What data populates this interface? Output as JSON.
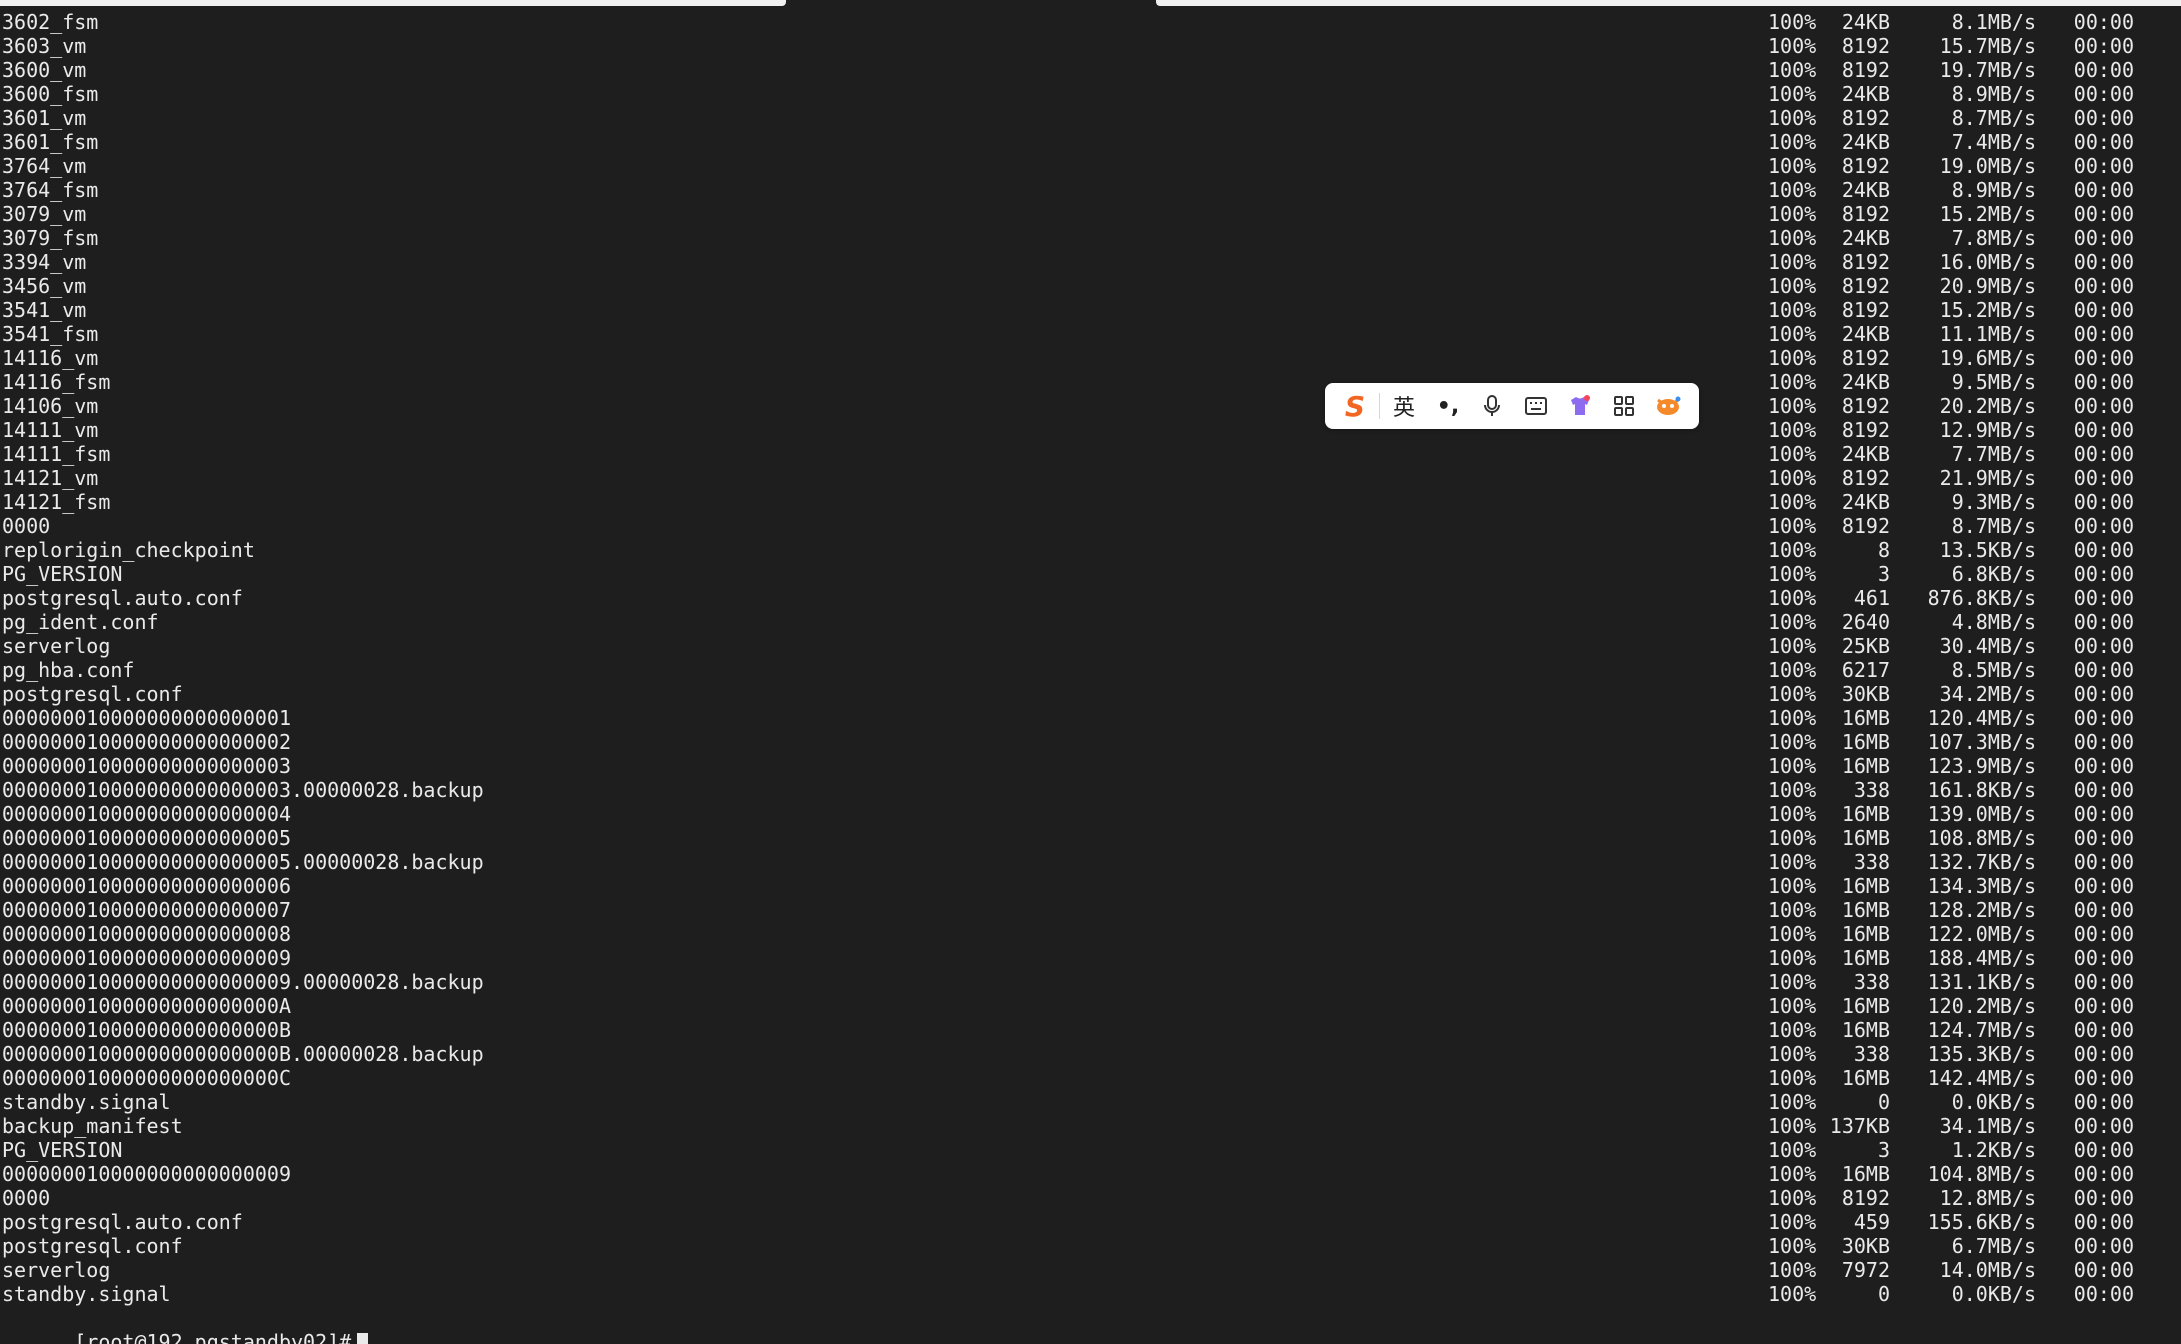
{
  "transfers": [
    {
      "name": "3602_fsm",
      "pct": "100%",
      "size": "24KB",
      "rate": "8.1MB/s",
      "eta": "00:00"
    },
    {
      "name": "3603_vm",
      "pct": "100%",
      "size": "8192",
      "rate": "15.7MB/s",
      "eta": "00:00"
    },
    {
      "name": "3600_vm",
      "pct": "100%",
      "size": "8192",
      "rate": "19.7MB/s",
      "eta": "00:00"
    },
    {
      "name": "3600_fsm",
      "pct": "100%",
      "size": "24KB",
      "rate": "8.9MB/s",
      "eta": "00:00"
    },
    {
      "name": "3601_vm",
      "pct": "100%",
      "size": "8192",
      "rate": "8.7MB/s",
      "eta": "00:00"
    },
    {
      "name": "3601_fsm",
      "pct": "100%",
      "size": "24KB",
      "rate": "7.4MB/s",
      "eta": "00:00"
    },
    {
      "name": "3764_vm",
      "pct": "100%",
      "size": "8192",
      "rate": "19.0MB/s",
      "eta": "00:00"
    },
    {
      "name": "3764_fsm",
      "pct": "100%",
      "size": "24KB",
      "rate": "8.9MB/s",
      "eta": "00:00"
    },
    {
      "name": "3079_vm",
      "pct": "100%",
      "size": "8192",
      "rate": "15.2MB/s",
      "eta": "00:00"
    },
    {
      "name": "3079_fsm",
      "pct": "100%",
      "size": "24KB",
      "rate": "7.8MB/s",
      "eta": "00:00"
    },
    {
      "name": "3394_vm",
      "pct": "100%",
      "size": "8192",
      "rate": "16.0MB/s",
      "eta": "00:00"
    },
    {
      "name": "3456_vm",
      "pct": "100%",
      "size": "8192",
      "rate": "20.9MB/s",
      "eta": "00:00"
    },
    {
      "name": "3541_vm",
      "pct": "100%",
      "size": "8192",
      "rate": "15.2MB/s",
      "eta": "00:00"
    },
    {
      "name": "3541_fsm",
      "pct": "100%",
      "size": "24KB",
      "rate": "11.1MB/s",
      "eta": "00:00"
    },
    {
      "name": "14116_vm",
      "pct": "100%",
      "size": "8192",
      "rate": "19.6MB/s",
      "eta": "00:00"
    },
    {
      "name": "14116_fsm",
      "pct": "100%",
      "size": "24KB",
      "rate": "9.5MB/s",
      "eta": "00:00"
    },
    {
      "name": "14106_vm",
      "pct": "100%",
      "size": "8192",
      "rate": "20.2MB/s",
      "eta": "00:00"
    },
    {
      "name": "14111_vm",
      "pct": "100%",
      "size": "8192",
      "rate": "12.9MB/s",
      "eta": "00:00"
    },
    {
      "name": "14111_fsm",
      "pct": "100%",
      "size": "24KB",
      "rate": "7.7MB/s",
      "eta": "00:00"
    },
    {
      "name": "14121_vm",
      "pct": "100%",
      "size": "8192",
      "rate": "21.9MB/s",
      "eta": "00:00"
    },
    {
      "name": "14121_fsm",
      "pct": "100%",
      "size": "24KB",
      "rate": "9.3MB/s",
      "eta": "00:00"
    },
    {
      "name": "0000",
      "pct": "100%",
      "size": "8192",
      "rate": "8.7MB/s",
      "eta": "00:00"
    },
    {
      "name": "replorigin_checkpoint",
      "pct": "100%",
      "size": "8",
      "rate": "13.5KB/s",
      "eta": "00:00"
    },
    {
      "name": "PG_VERSION",
      "pct": "100%",
      "size": "3",
      "rate": "6.8KB/s",
      "eta": "00:00"
    },
    {
      "name": "postgresql.auto.conf",
      "pct": "100%",
      "size": "461",
      "rate": "876.8KB/s",
      "eta": "00:00"
    },
    {
      "name": "pg_ident.conf",
      "pct": "100%",
      "size": "2640",
      "rate": "4.8MB/s",
      "eta": "00:00"
    },
    {
      "name": "serverlog",
      "pct": "100%",
      "size": "25KB",
      "rate": "30.4MB/s",
      "eta": "00:00"
    },
    {
      "name": "pg_hba.conf",
      "pct": "100%",
      "size": "6217",
      "rate": "8.5MB/s",
      "eta": "00:00"
    },
    {
      "name": "postgresql.conf",
      "pct": "100%",
      "size": "30KB",
      "rate": "34.2MB/s",
      "eta": "00:00"
    },
    {
      "name": "000000010000000000000001",
      "pct": "100%",
      "size": "16MB",
      "rate": "120.4MB/s",
      "eta": "00:00"
    },
    {
      "name": "000000010000000000000002",
      "pct": "100%",
      "size": "16MB",
      "rate": "107.3MB/s",
      "eta": "00:00"
    },
    {
      "name": "000000010000000000000003",
      "pct": "100%",
      "size": "16MB",
      "rate": "123.9MB/s",
      "eta": "00:00"
    },
    {
      "name": "000000010000000000000003.00000028.backup",
      "pct": "100%",
      "size": "338",
      "rate": "161.8KB/s",
      "eta": "00:00"
    },
    {
      "name": "000000010000000000000004",
      "pct": "100%",
      "size": "16MB",
      "rate": "139.0MB/s",
      "eta": "00:00"
    },
    {
      "name": "000000010000000000000005",
      "pct": "100%",
      "size": "16MB",
      "rate": "108.8MB/s",
      "eta": "00:00"
    },
    {
      "name": "000000010000000000000005.00000028.backup",
      "pct": "100%",
      "size": "338",
      "rate": "132.7KB/s",
      "eta": "00:00"
    },
    {
      "name": "000000010000000000000006",
      "pct": "100%",
      "size": "16MB",
      "rate": "134.3MB/s",
      "eta": "00:00"
    },
    {
      "name": "000000010000000000000007",
      "pct": "100%",
      "size": "16MB",
      "rate": "128.2MB/s",
      "eta": "00:00"
    },
    {
      "name": "000000010000000000000008",
      "pct": "100%",
      "size": "16MB",
      "rate": "122.0MB/s",
      "eta": "00:00"
    },
    {
      "name": "000000010000000000000009",
      "pct": "100%",
      "size": "16MB",
      "rate": "188.4MB/s",
      "eta": "00:00"
    },
    {
      "name": "000000010000000000000009.00000028.backup",
      "pct": "100%",
      "size": "338",
      "rate": "131.1KB/s",
      "eta": "00:00"
    },
    {
      "name": "00000001000000000000000A",
      "pct": "100%",
      "size": "16MB",
      "rate": "120.2MB/s",
      "eta": "00:00"
    },
    {
      "name": "00000001000000000000000B",
      "pct": "100%",
      "size": "16MB",
      "rate": "124.7MB/s",
      "eta": "00:00"
    },
    {
      "name": "00000001000000000000000B.00000028.backup",
      "pct": "100%",
      "size": "338",
      "rate": "135.3KB/s",
      "eta": "00:00"
    },
    {
      "name": "00000001000000000000000C",
      "pct": "100%",
      "size": "16MB",
      "rate": "142.4MB/s",
      "eta": "00:00"
    },
    {
      "name": "standby.signal",
      "pct": "100%",
      "size": "0",
      "rate": "0.0KB/s",
      "eta": "00:00"
    },
    {
      "name": "backup_manifest",
      "pct": "100%",
      "size": "137KB",
      "rate": "34.1MB/s",
      "eta": "00:00"
    },
    {
      "name": "PG_VERSION",
      "pct": "100%",
      "size": "3",
      "rate": "1.2KB/s",
      "eta": "00:00"
    },
    {
      "name": "000000010000000000000009",
      "pct": "100%",
      "size": "16MB",
      "rate": "104.8MB/s",
      "eta": "00:00"
    },
    {
      "name": "0000",
      "pct": "100%",
      "size": "8192",
      "rate": "12.8MB/s",
      "eta": "00:00"
    },
    {
      "name": "postgresql.auto.conf",
      "pct": "100%",
      "size": "459",
      "rate": "155.6KB/s",
      "eta": "00:00"
    },
    {
      "name": "postgresql.conf",
      "pct": "100%",
      "size": "30KB",
      "rate": "6.7MB/s",
      "eta": "00:00"
    },
    {
      "name": "serverlog",
      "pct": "100%",
      "size": "7972",
      "rate": "14.0MB/s",
      "eta": "00:00"
    },
    {
      "name": "standby.signal",
      "pct": "100%",
      "size": "0",
      "rate": "0.0KB/s",
      "eta": "00:00"
    }
  ],
  "prompt": "[root@192 pgstandby02]#",
  "ime_toolbar": {
    "logo": "S",
    "language": "英",
    "punctuation": "•,",
    "items": [
      "logo-icon",
      "language-toggle",
      "punctuation-icon",
      "microphone-icon",
      "keyboard-icon",
      "skin-icon",
      "grid-icon",
      "mascot-icon"
    ]
  },
  "colors": {
    "background": "#1e1e1e",
    "text": "#eaeaea",
    "ime_accent": "#f26522"
  }
}
